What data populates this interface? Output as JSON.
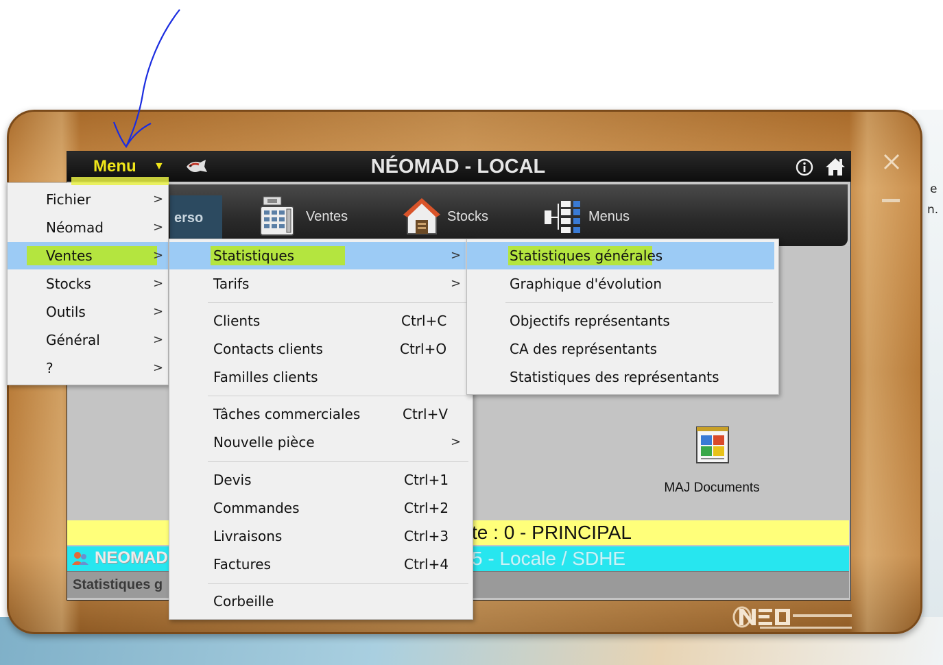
{
  "window": {
    "menu_button_label": "Menu",
    "menu_button_arrow": "▼",
    "title": "NÉOMAD - LOCAL",
    "info_icon": "info-icon",
    "home_icon": "home-icon",
    "close_glyph": "✕"
  },
  "toolbar": {
    "tab_perso_label": "erso",
    "items": [
      {
        "label": "Ventes",
        "icon": "cash-register-icon"
      },
      {
        "label": "Stocks",
        "icon": "warehouse-icon"
      },
      {
        "label": "Menus",
        "icon": "menu-tree-icon"
      }
    ]
  },
  "content": {
    "maj_documents_label": "MAJ Documents",
    "depot_text": "te : 0 - PRINCIPAL",
    "site_text": "5 - Locale / SDHE",
    "neomad_label": "NEOMAD",
    "status_text": "Statistiques g"
  },
  "main_menu": {
    "items": [
      {
        "label": "Fichier",
        "chevron": ">"
      },
      {
        "label": "Néomad",
        "chevron": ">"
      },
      {
        "label": "Ventes",
        "chevron": ">",
        "selected": true
      },
      {
        "label": "Stocks",
        "chevron": ">"
      },
      {
        "label": "Outils",
        "chevron": ">"
      },
      {
        "label": "Général",
        "chevron": ">"
      },
      {
        "label": "?",
        "chevron": ">"
      }
    ]
  },
  "ventes_menu": {
    "items": [
      {
        "label": "Statistiques",
        "chevron": ">",
        "selected": true
      },
      {
        "label": "Tarifs",
        "chevron": ">"
      },
      {
        "label": "Clients",
        "shortcut": "Ctrl+C"
      },
      {
        "label": "Contacts clients",
        "shortcut": "Ctrl+O"
      },
      {
        "label": "Familles clients"
      },
      {
        "label": "Tâches commerciales",
        "shortcut": "Ctrl+V"
      },
      {
        "label": "Nouvelle pièce",
        "chevron": ">"
      },
      {
        "label": "Devis",
        "shortcut": "Ctrl+1"
      },
      {
        "label": "Commandes",
        "shortcut": "Ctrl+2"
      },
      {
        "label": "Livraisons",
        "shortcut": "Ctrl+3"
      },
      {
        "label": "Factures",
        "shortcut": "Ctrl+4"
      },
      {
        "label": "Corbeille"
      }
    ]
  },
  "stats_menu": {
    "items": [
      {
        "label": "Statistiques générales",
        "selected": true
      },
      {
        "label": "Graphique d'évolution"
      },
      {
        "label": "Objectifs représentants"
      },
      {
        "label": "CA des représentants"
      },
      {
        "label": "Statistiques des représentants"
      }
    ]
  },
  "background_text": {
    "right_line_1": "e",
    "right_line_2": "n."
  },
  "colors": {
    "frame_bronze": "#b77936",
    "title_bar": "#111111",
    "menu_label_yellow": "#f0e61a",
    "selection_blue": "#9ccbf5",
    "highlighter_green": "#b8ea1e",
    "depot_yellow": "#ffff7a",
    "site_cyan": "#27e6ef"
  }
}
